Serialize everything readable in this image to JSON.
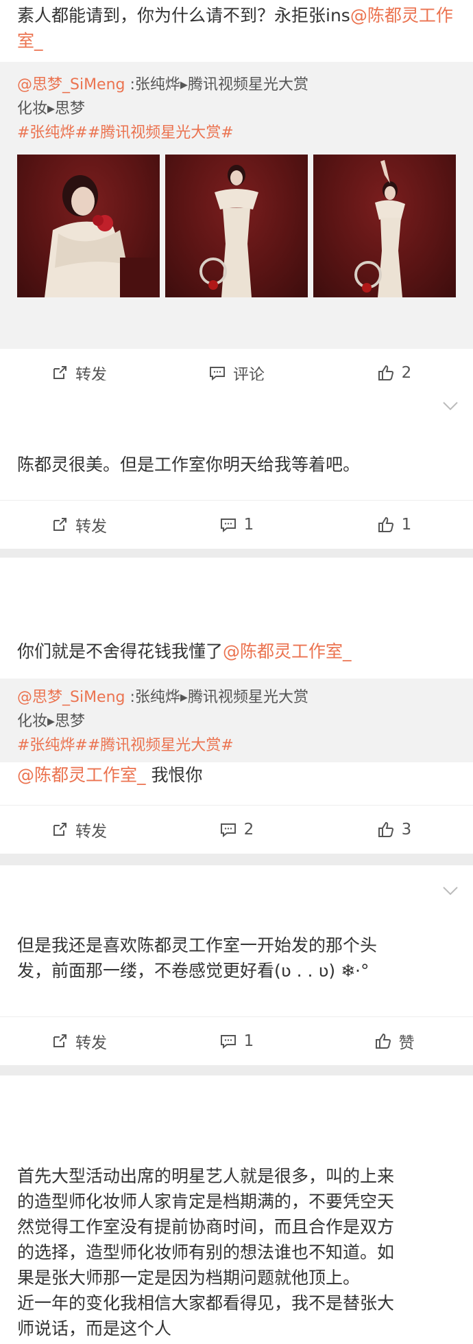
{
  "post1": {
    "text_prefix": "素人都能请到，你为什么请不到？永拒张ins",
    "mention": "@陈都灵工作室_",
    "quote": {
      "author": "@思梦_SiMeng",
      "line1_rest": " :张纯烨▸腾讯视频星光大赏",
      "line2": "化妆▸思梦",
      "tags": "#张纯烨##腾讯视频星光大赏#"
    },
    "actions": {
      "repost": "转发",
      "comment": "评论",
      "like": "2"
    }
  },
  "post2": {
    "text": "陈都灵很美。但是工作室你明天给我等着吧。",
    "actions": {
      "repost": "转发",
      "comment": "1",
      "like": "1"
    }
  },
  "post3": {
    "text_prefix": "你们就是不舍得花钱我懂了",
    "mention": "@陈都灵工作室_",
    "quote": {
      "author": "@思梦_SiMeng",
      "line1_rest": " :张纯烨▸腾讯视频星光大赏",
      "line2": "化妆▸思梦",
      "tags": "#张纯烨##腾讯视频星光大赏#"
    },
    "reply_mention": "@陈都灵工作室_",
    "reply_text": " 我恨你",
    "actions": {
      "repost": "转发",
      "comment": "2",
      "like": "3"
    }
  },
  "post4": {
    "line1": "但是我还是喜欢陈都灵工作室一开始发的那个头",
    "line2": "发，前面那一缕，不卷感觉更好看(ʋ . . ʋ) ❄·°",
    "actions": {
      "repost": "转发",
      "comment": "1",
      "like": "赞"
    }
  },
  "post5": {
    "lines": [
      "首先大型活动出席的明星艺人就是很多，叫的上来",
      "的造型师化妆师人家肯定是档期满的，不要凭空天",
      "然觉得工作室没有提前协商时间，而且合作是双方",
      "的选择，造型师化妆师有别的想法谁也不知道。如",
      "果是张大师那一定是因为档期问题就他顶上。",
      "近一年的变化我相信大家都看得见，我不是替张大",
      "师说话，而是这个人"
    ]
  }
}
